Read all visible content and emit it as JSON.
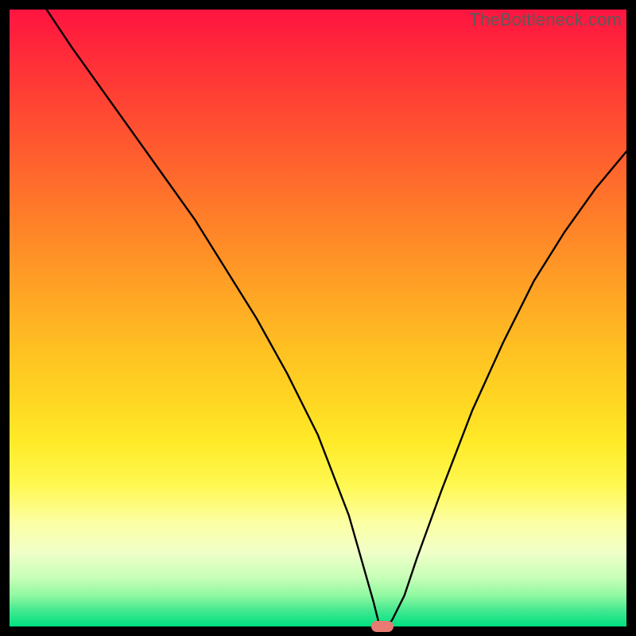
{
  "watermark": {
    "text": "TheBottleneck.com"
  },
  "colors": {
    "frame": "#000000",
    "marker": "#e77a72",
    "curve": "#000000",
    "gradient_top": "#ff1440",
    "gradient_bottom": "#00e080"
  },
  "chart_data": {
    "type": "line",
    "title": "",
    "xlabel": "",
    "ylabel": "",
    "xlim": [
      0,
      100
    ],
    "ylim": [
      0,
      100
    ],
    "grid": false,
    "legend": false,
    "series": [
      {
        "name": "curve",
        "x": [
          6,
          10,
          15,
          20,
          25,
          30,
          35,
          40,
          45,
          50,
          55,
          57,
          59,
          60,
          61,
          62,
          64,
          66,
          70,
          75,
          80,
          85,
          90,
          95,
          100
        ],
        "y": [
          100,
          94,
          87,
          80,
          73,
          66,
          58,
          50,
          41,
          31,
          18,
          11,
          4,
          0,
          0,
          1,
          5,
          11,
          22,
          35,
          46,
          56,
          64,
          71,
          77
        ]
      }
    ],
    "marker": {
      "x": 60.5,
      "y": 0
    }
  }
}
